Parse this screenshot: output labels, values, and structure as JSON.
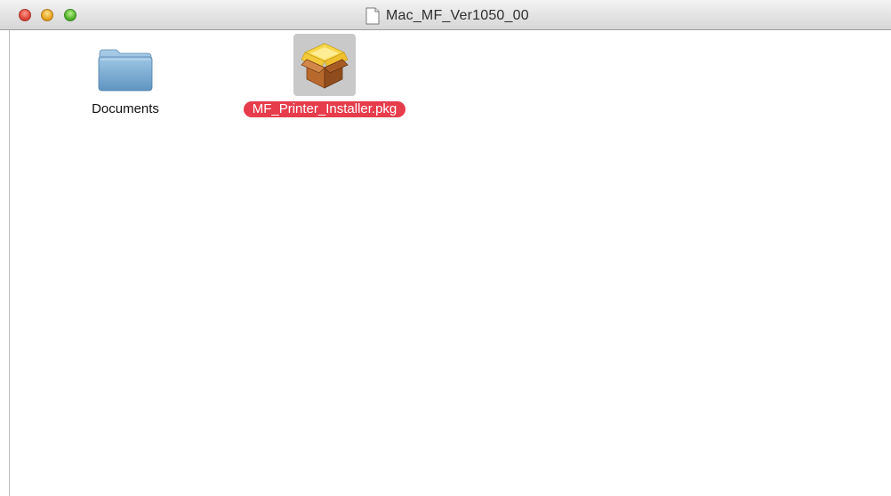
{
  "window": {
    "title": "Mac_MF_Ver1050_00"
  },
  "files": [
    {
      "name": "Documents",
      "icon": "folder-icon",
      "selected": false
    },
    {
      "name": "MF_Printer_Installer.pkg",
      "icon": "package-icon",
      "selected": true
    }
  ],
  "colors": {
    "selection_label": "#e63c4b",
    "selection_icon_bg": "#c9c9c9",
    "folder": "#7fb2d9"
  }
}
